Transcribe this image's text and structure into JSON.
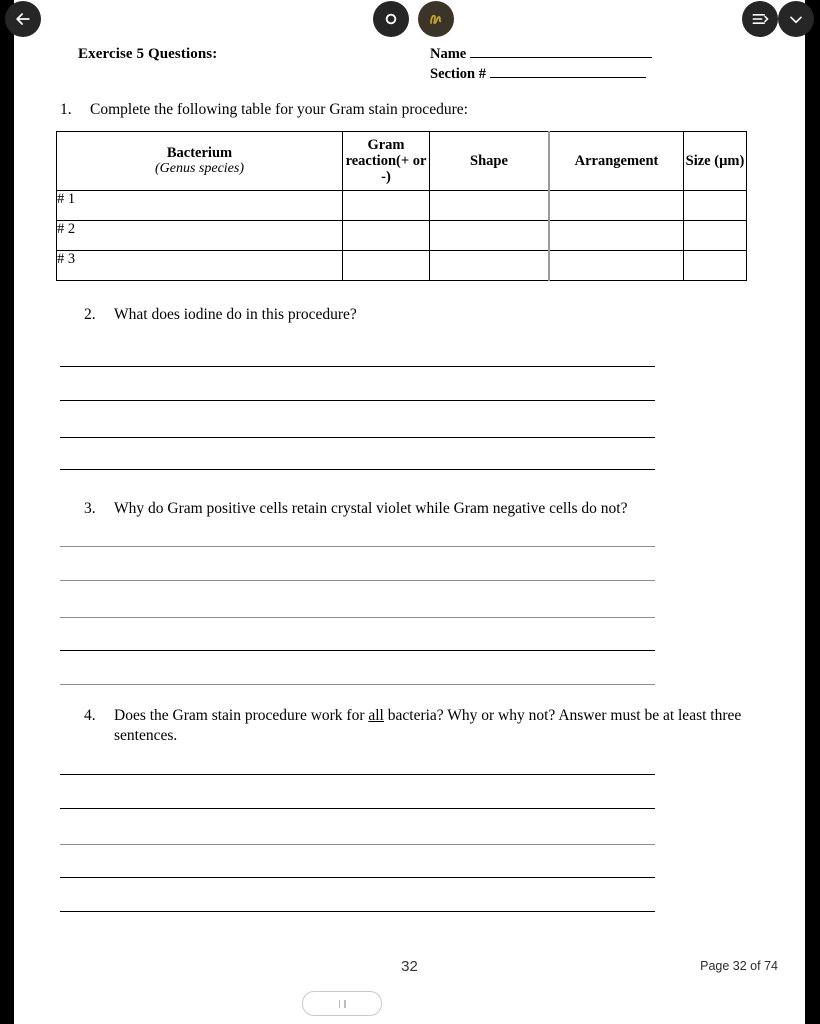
{
  "toolbar": {
    "back_label": "Back",
    "back_icon": "arrow-left-icon",
    "circle_tool_label": "Circle",
    "circle_icon": "circle-outline-icon",
    "pen_tool_label": "Annotate",
    "pen_icon": "handwriting-pen-icon",
    "pen_color": "#c9a227",
    "outline_label": "Outline",
    "outline_icon": "list-outline-icon",
    "collapse_label": "Collapse",
    "collapse_icon": "chevron-down-icon"
  },
  "document": {
    "header": {
      "exercise_title": "Exercise 5 Questions:",
      "name_label": "Name",
      "section_label": "Section #"
    },
    "questions": [
      {
        "number": "1.",
        "text": "Complete the following table for your Gram stain procedure:",
        "answer_lines": 0
      },
      {
        "number": "2.",
        "text": "What does iodine do in this procedure?",
        "answer_lines": 4
      },
      {
        "number": "3.",
        "text": "Why do Gram positive cells retain crystal violet while Gram negative cells do not?",
        "answer_lines": 5
      },
      {
        "number": "4.",
        "text_before": "Does the Gram stain procedure work for ",
        "underlined": "all",
        "text_after": " bacteria?  Why or why not? Answer must be at least three sentences.",
        "answer_lines": 5
      }
    ],
    "table": {
      "headers": [
        {
          "main": "Bacterium",
          "sub": "(Genus species)"
        },
        {
          "main": "Gram reaction(+ or -)",
          "sub": ""
        },
        {
          "main": "Shape",
          "sub": ""
        },
        {
          "main": "Arrangement",
          "sub": ""
        },
        {
          "main": "Size (µm)",
          "sub": ""
        }
      ],
      "rows": [
        {
          "label": "# 1",
          "gram": "",
          "shape": "",
          "arrangement": "",
          "size": ""
        },
        {
          "label": "# 2",
          "gram": "",
          "shape": "",
          "arrangement": "",
          "size": ""
        },
        {
          "label": "# 3",
          "gram": "",
          "shape": "",
          "arrangement": "",
          "size": ""
        }
      ]
    },
    "footer": {
      "page_number": "32"
    }
  },
  "viewer": {
    "page_indicator": "Page 32 of 74",
    "scrubber_label": "Page scrubber"
  }
}
